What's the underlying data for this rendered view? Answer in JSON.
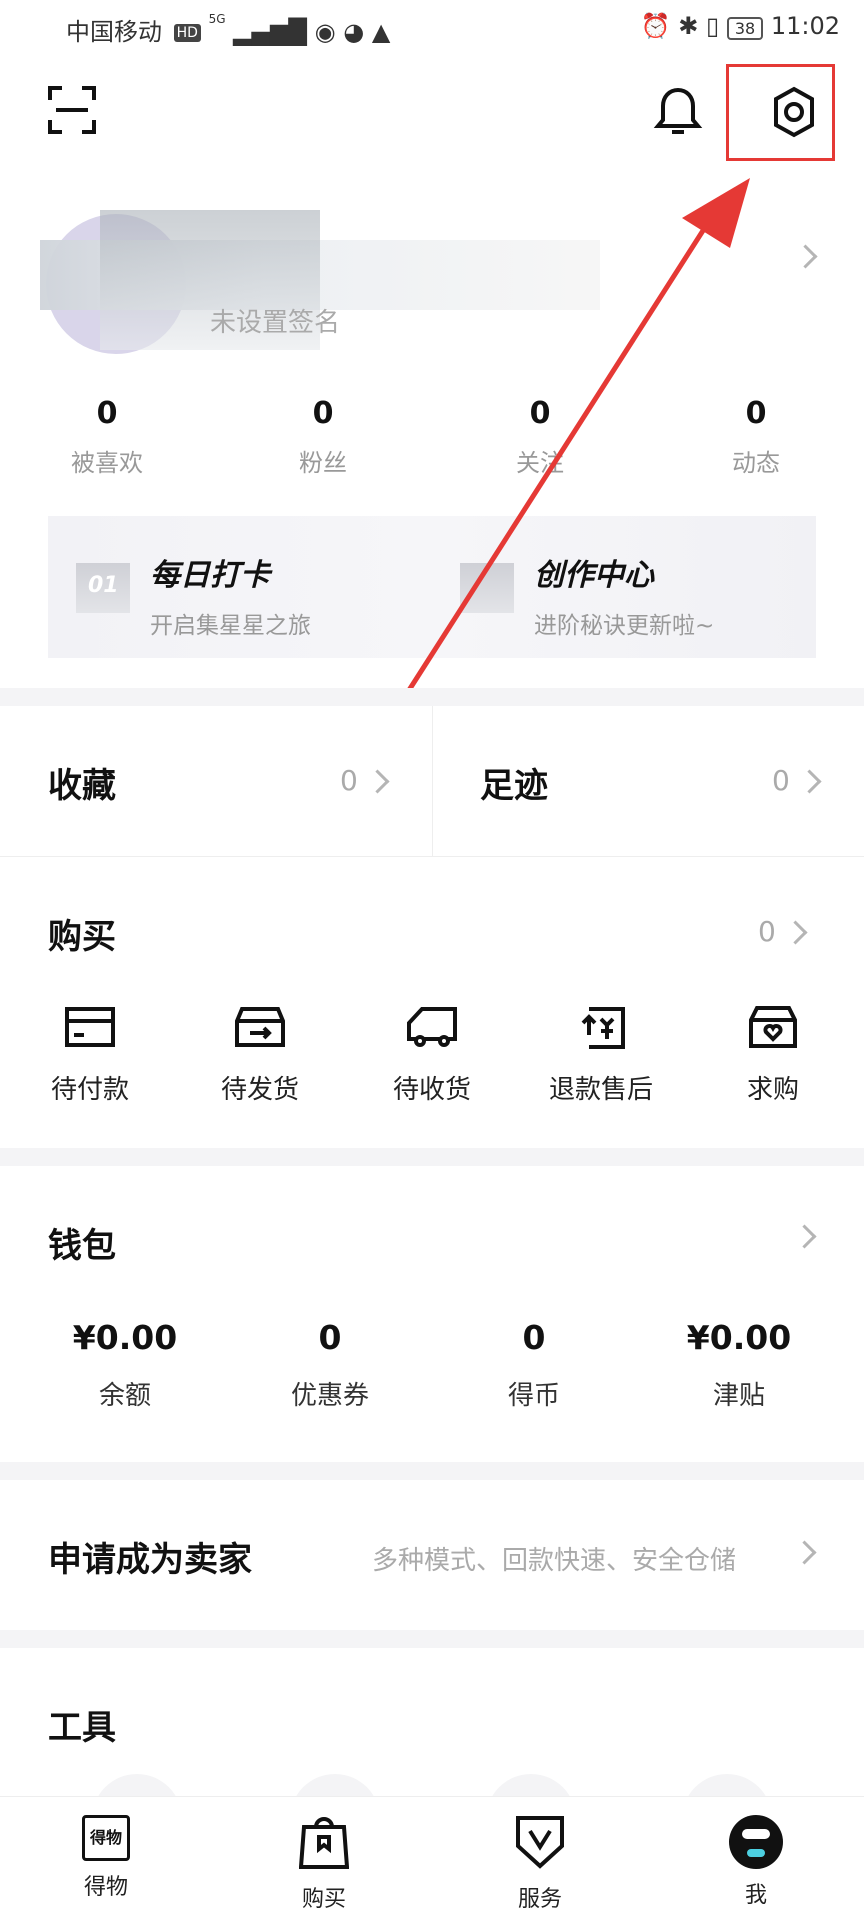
{
  "status_bar": {
    "carrier": "中国移动",
    "hd_badge": "HD",
    "network": "5G",
    "battery": "38",
    "time": "11:02"
  },
  "header": {
    "scan_icon": "scan-icon",
    "bell_icon": "bell-icon",
    "settings_icon": "gear-icon"
  },
  "profile": {
    "signature": "未设置签名"
  },
  "stats": [
    {
      "value": "0",
      "label": "被喜欢"
    },
    {
      "value": "0",
      "label": "粉丝"
    },
    {
      "value": "0",
      "label": "关注"
    },
    {
      "value": "0",
      "label": "动态"
    }
  ],
  "cards": [
    {
      "title": "每日打卡",
      "subtitle": "开启集星星之旅",
      "icon_text": "01"
    },
    {
      "title": "创作中心",
      "subtitle": "进阶秘诀更新啦~"
    }
  ],
  "collect": {
    "label": "收藏",
    "count": "0"
  },
  "footprint": {
    "label": "足迹",
    "count": "0"
  },
  "purchase": {
    "title": "购买",
    "count": "0",
    "items": [
      {
        "label": "待付款",
        "icon": "card-icon"
      },
      {
        "label": "待发货",
        "icon": "box-icon"
      },
      {
        "label": "待收货",
        "icon": "truck-icon"
      },
      {
        "label": "退款售后",
        "icon": "refund-icon"
      },
      {
        "label": "求购",
        "icon": "heart-bag-icon"
      }
    ]
  },
  "wallet": {
    "title": "钱包",
    "items": [
      {
        "value": "¥0.00",
        "label": "余额"
      },
      {
        "value": "0",
        "label": "优惠券"
      },
      {
        "value": "0",
        "label": "得币"
      },
      {
        "value": "¥0.00",
        "label": "津贴"
      }
    ]
  },
  "seller": {
    "title": "申请成为卖家",
    "subtitle": "多种模式、回款快速、安全仓储"
  },
  "tools": {
    "title": "工具"
  },
  "tabbar": [
    {
      "label": "得物",
      "icon": "dewu-icon",
      "icon_text": "得物"
    },
    {
      "label": "购买",
      "icon": "shopping-bag-icon"
    },
    {
      "label": "服务",
      "icon": "service-shield-icon"
    },
    {
      "label": "我",
      "icon": "avatar-icon"
    }
  ],
  "colors": {
    "annotation_red": "#e53935",
    "separator": "#f4f4f6",
    "muted_text": "#999999"
  }
}
